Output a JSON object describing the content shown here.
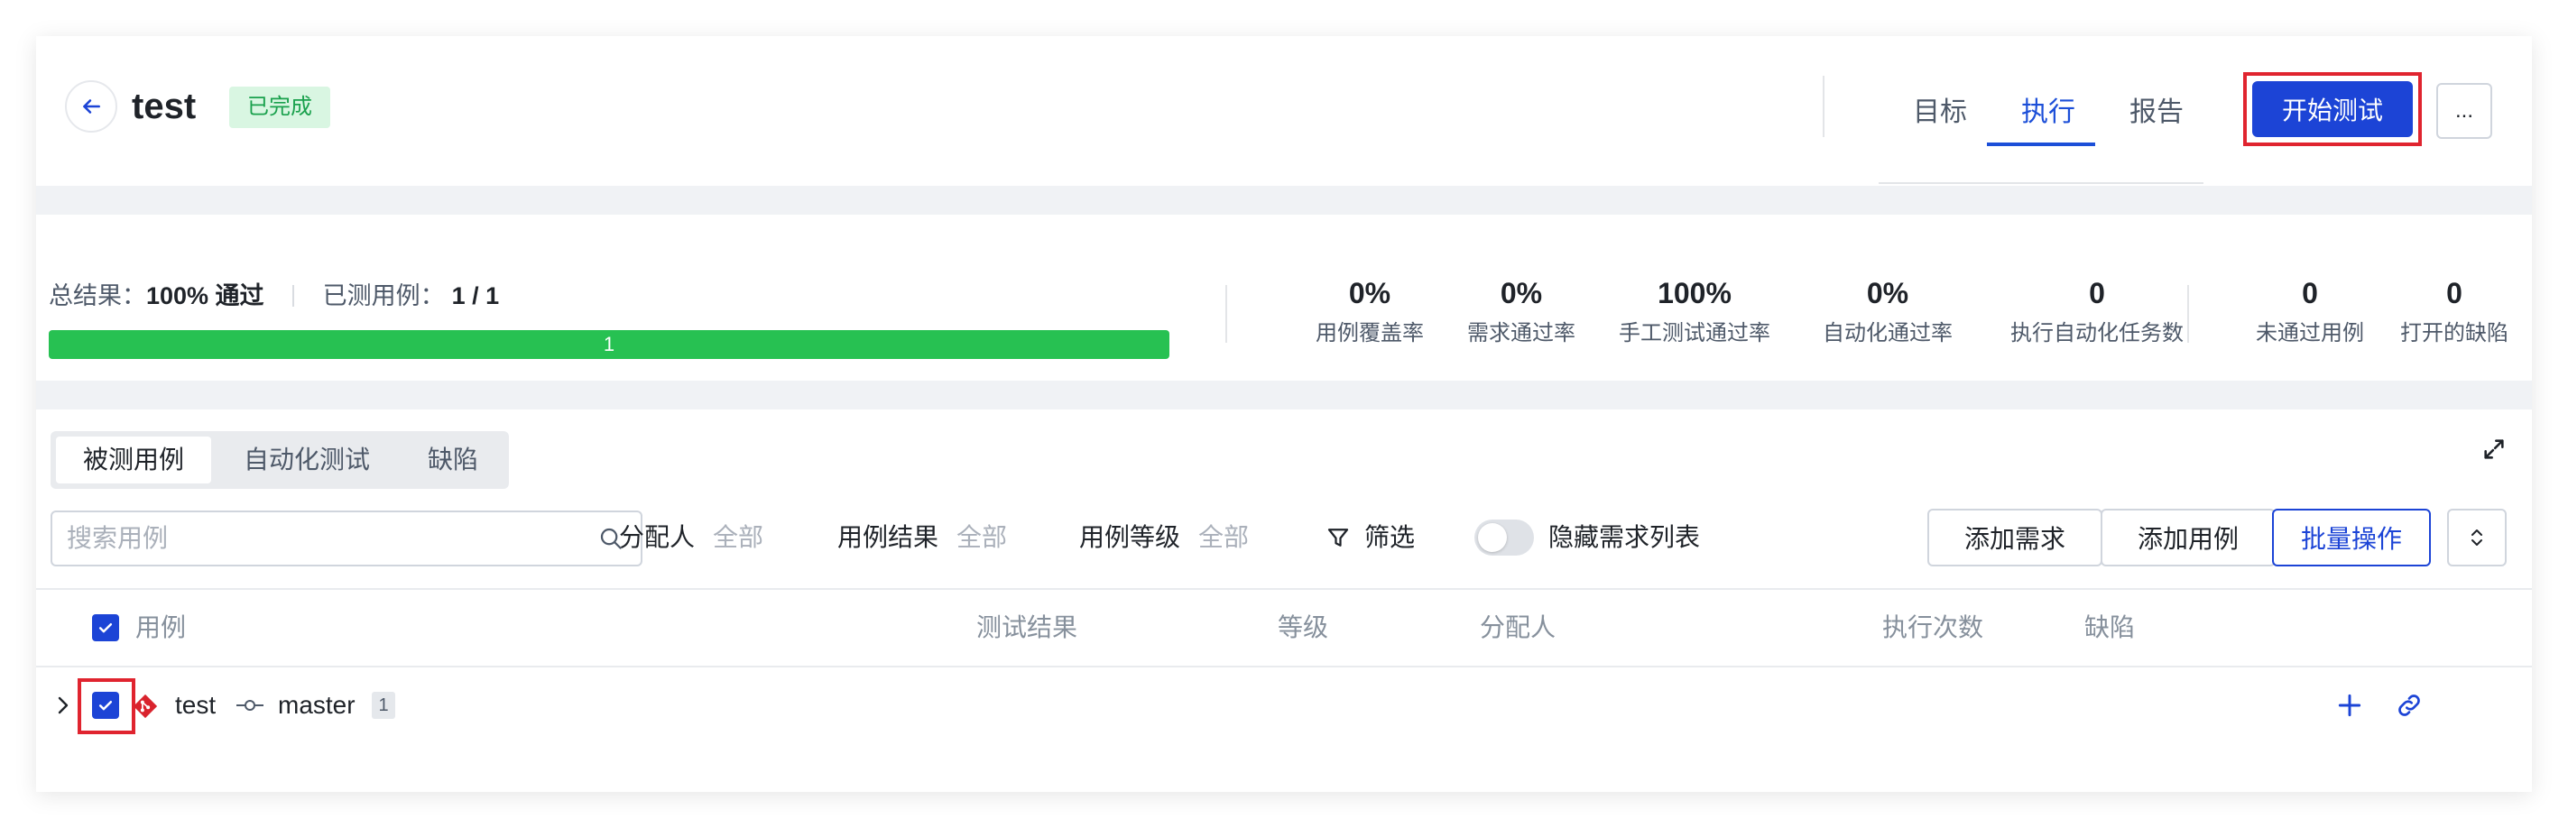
{
  "header": {
    "title": "test",
    "status": "已完成",
    "tabs": [
      {
        "label": "目标",
        "active": false
      },
      {
        "label": "执行",
        "active": true
      },
      {
        "label": "报告",
        "active": false
      }
    ],
    "start_button": "开始测试",
    "more_button": "..."
  },
  "summary": {
    "result_label": "总结果：",
    "result_value": "100% 通过",
    "tested_label": "已测用例：",
    "tested_value": "1 / 1",
    "progress_label": "1",
    "progress_fraction": 1.0,
    "metrics": [
      {
        "value": "0%",
        "label": "用例覆盖率"
      },
      {
        "value": "0%",
        "label": "需求通过率"
      },
      {
        "value": "100%",
        "label": "手工测试通过率"
      },
      {
        "value": "0%",
        "label": "自动化通过率"
      },
      {
        "value": "0",
        "label": "执行自动化任务数"
      },
      {
        "value": "0",
        "label": "未通过用例"
      },
      {
        "value": "0",
        "label": "打开的缺陷"
      }
    ]
  },
  "main": {
    "segments": [
      "被测用例",
      "自动化测试",
      "缺陷"
    ],
    "active_segment": 0,
    "search_placeholder": "搜索用例",
    "filters": [
      {
        "label": "分配人",
        "value": "全部"
      },
      {
        "label": "用例结果",
        "value": "全部"
      },
      {
        "label": "用例等级",
        "value": "全部"
      }
    ],
    "filter_button": "筛选",
    "hide_toggle_label": "隐藏需求列表",
    "hide_toggle_on": false,
    "add_requirement": "添加需求",
    "add_case": "添加用例",
    "batch": "批量操作",
    "columns": [
      "用例",
      "测试结果",
      "等级",
      "分配人",
      "执行次数",
      "缺陷"
    ],
    "rows": [
      {
        "name": "test",
        "branch": "master",
        "count": "1",
        "checked": true
      }
    ]
  },
  "colors": {
    "primary": "#1c44d6",
    "success": "#27c152",
    "highlight": "#e0242f",
    "git": "#d9232d"
  }
}
